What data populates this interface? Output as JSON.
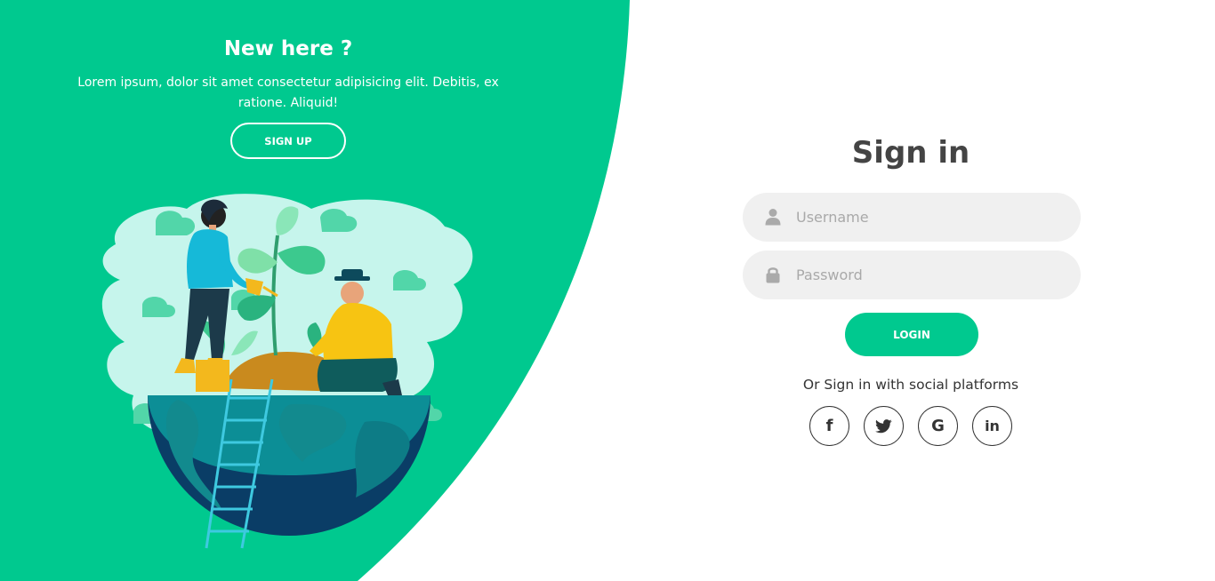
{
  "panel": {
    "title": "New here ?",
    "text": "Lorem ipsum, dolor sit amet consectetur adipisicing elit. Debitis, ex ratione. Aliquid!",
    "signup_label": "SIGN UP"
  },
  "form": {
    "title": "Sign in",
    "username_placeholder": "Username",
    "password_placeholder": "Password",
    "login_label": "LOGIN",
    "social_text": "Or Sign in with social platforms",
    "social": [
      {
        "name": "facebook",
        "icon": "facebook-icon",
        "glyph": "f"
      },
      {
        "name": "twitter",
        "icon": "twitter-icon",
        "glyph": ""
      },
      {
        "name": "google",
        "icon": "google-icon",
        "glyph": "G"
      },
      {
        "name": "linkedin",
        "icon": "linkedin-icon",
        "glyph": "in"
      }
    ]
  },
  "colors": {
    "accent": "#00c98f",
    "field_bg": "#f0f0f0",
    "title_text": "#444444",
    "placeholder": "#a9a9a9"
  }
}
